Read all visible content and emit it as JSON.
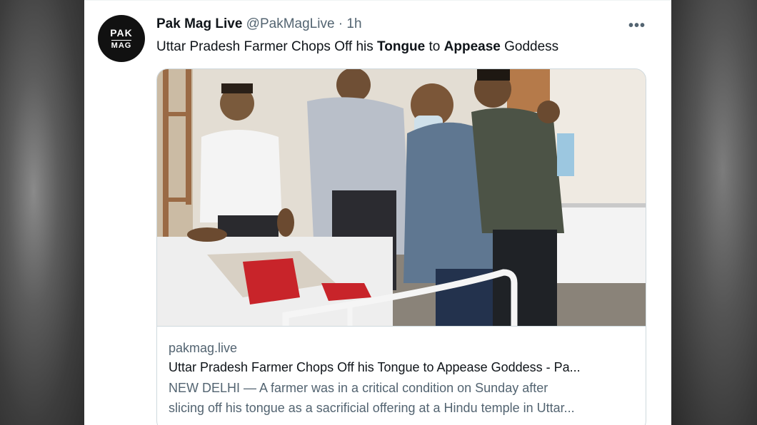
{
  "tweet": {
    "author_name": "Pak Mag Live",
    "handle": "@PakMagLive",
    "separator": "·",
    "time": "1h",
    "avatar_line1": "PAK",
    "avatar_line2": "MAG",
    "more_label": "•••",
    "text_parts": [
      "Uttar Pradesh Farmer Chops Off his ",
      "Tongue",
      " to ",
      "Appease",
      " Goddess"
    ]
  },
  "card": {
    "domain": "pakmag.live",
    "title": "Uttar Pradesh Farmer Chops Off his Tongue to Appease Goddess - Pa...",
    "description_line1": "NEW DELHI — A farmer was in a critical condition on Sunday after",
    "description_line2": "slicing off his tongue as a sacrificial offering at a Hindu temple in Uttar..."
  }
}
